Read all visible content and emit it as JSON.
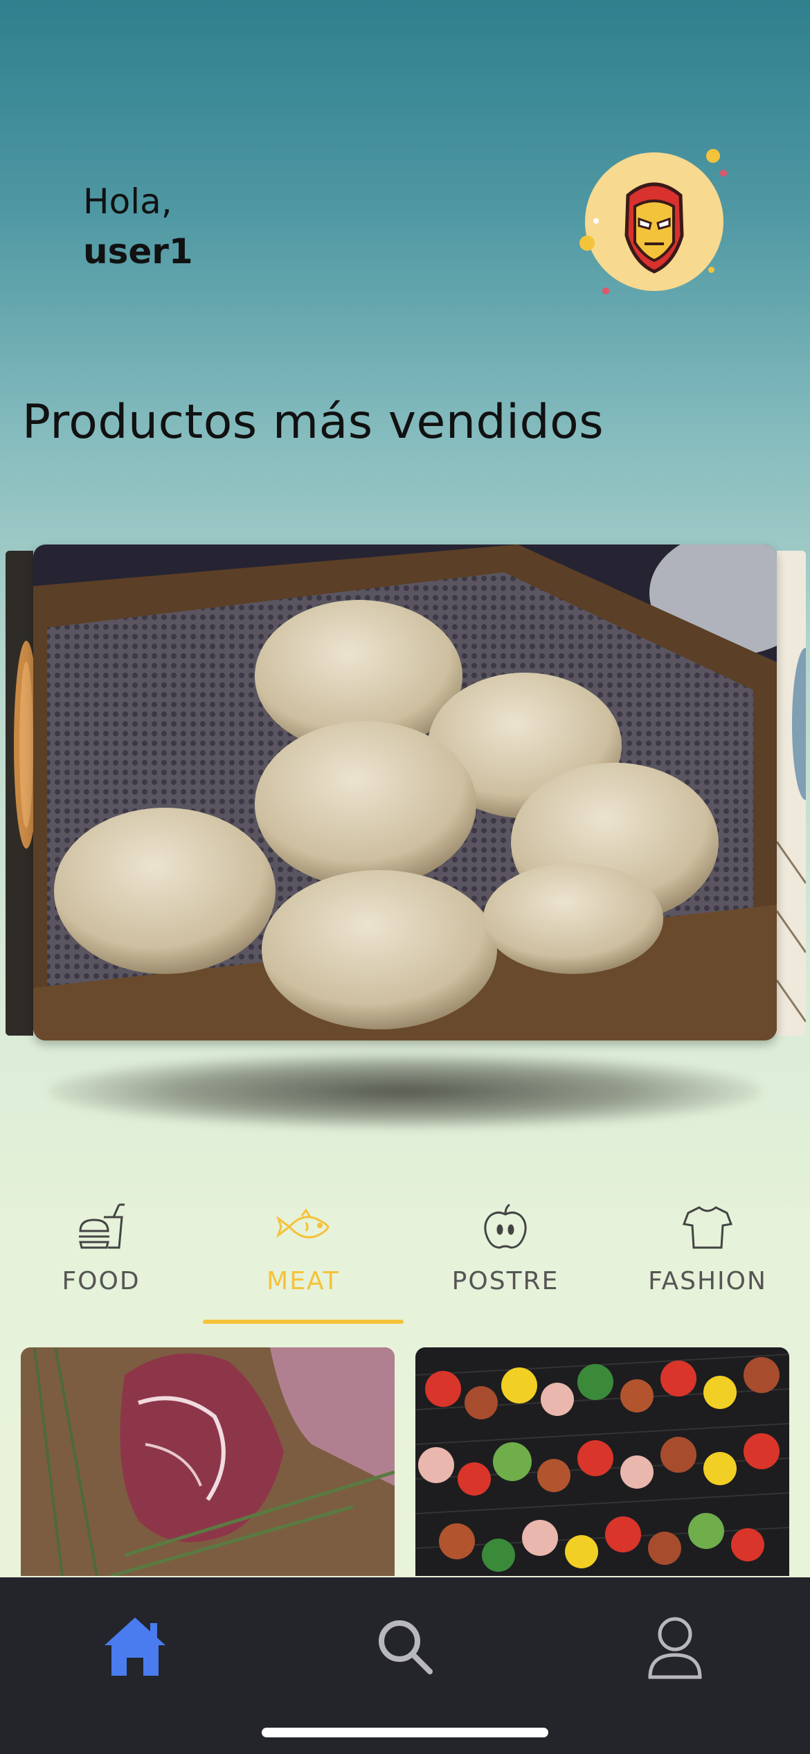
{
  "header": {
    "greeting": "Hola,",
    "username": "user1"
  },
  "avatar": {
    "icon": "iron-man-helmet-icon",
    "bg": "#f7d98f"
  },
  "section": {
    "title": "Productos más vendidos"
  },
  "carousel": {
    "current_image": "steamed-dumplings-photo"
  },
  "categories": {
    "active_color": "#f5c23a",
    "items": [
      {
        "label": "FOOD",
        "icon": "fast-food-icon"
      },
      {
        "label": "MEAT",
        "icon": "fish-icon"
      },
      {
        "label": "POSTRE",
        "icon": "apple-icon"
      },
      {
        "label": "FASHION",
        "icon": "t-shirt-icon"
      }
    ],
    "active_index": 1
  },
  "products": [
    {
      "image": "raw-steak-rosemary-photo"
    },
    {
      "image": "grilled-skewers-photo"
    }
  ],
  "bottom_nav": {
    "accent": "#4a7cf0",
    "items": [
      {
        "icon": "home-icon",
        "active": true
      },
      {
        "icon": "search-icon",
        "active": false
      },
      {
        "icon": "profile-icon",
        "active": false
      }
    ]
  }
}
